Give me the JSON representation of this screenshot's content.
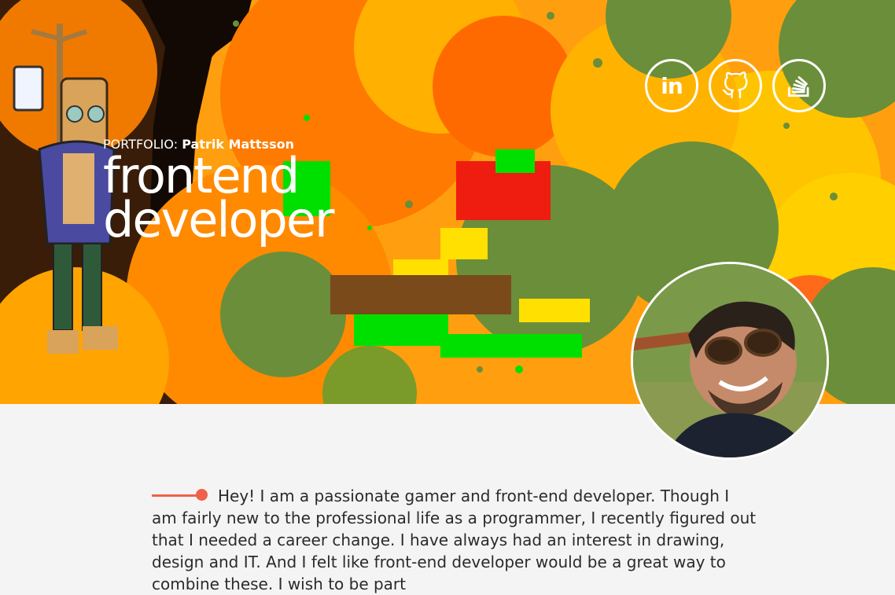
{
  "hero": {
    "eyebrow_prefix": "PORTFOLIO:",
    "eyebrow_name": "Patrik Mattsson",
    "title_line1": "frontend",
    "title_line2": "developer"
  },
  "social": {
    "linkedin_label": "in",
    "items": [
      "linkedin-icon",
      "github-icon",
      "stackoverflow-icon"
    ]
  },
  "intro": {
    "text": "Hey! I am a passionate gamer and front-end developer. Though I am fairly new to the professional life as a programmer, I recently figured out that I needed a career change. I have always had an interest in drawing, design and IT. And I felt like front-end developer would be a great way to combine these. I wish to be part"
  },
  "colors": {
    "accent": "#f0604a",
    "hero_orange": "#ff9f0f",
    "hero_green": "#6b8e3a",
    "page_bg": "#f4f4f4"
  }
}
